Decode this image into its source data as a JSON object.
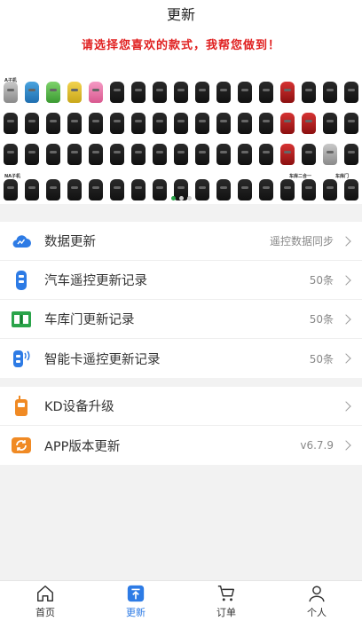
{
  "header": {
    "title": "更新"
  },
  "banner": {
    "slogan": "请选择您喜欢的款式，我帮您做到！",
    "row_labels": [
      "A子机",
      "NA子机",
      "车库二合一",
      "车库门"
    ]
  },
  "update_list": [
    {
      "label": "数据更新",
      "right_text": "遥控数据同步",
      "icon": "cloud-icon"
    },
    {
      "label": "汽车遥控更新记录",
      "right_text": "50条",
      "icon": "car-remote-icon"
    },
    {
      "label": "车库门更新记录",
      "right_text": "50条",
      "icon": "garage-door-icon"
    },
    {
      "label": "智能卡遥控更新记录",
      "right_text": "50条",
      "icon": "smart-card-icon"
    }
  ],
  "device_list": [
    {
      "label": "KD设备升级",
      "right_text": "",
      "icon": "kd-device-icon"
    },
    {
      "label": "APP版本更新",
      "right_text": "v6.7.9",
      "icon": "app-update-icon"
    }
  ],
  "tabbar": [
    {
      "label": "首页",
      "icon": "home-icon",
      "active": false
    },
    {
      "label": "更新",
      "icon": "update-icon",
      "active": true
    },
    {
      "label": "订单",
      "icon": "cart-icon",
      "active": false
    },
    {
      "label": "个人",
      "icon": "person-icon",
      "active": false
    }
  ],
  "colors": {
    "accent": "#2d7be5",
    "slogan": "#e02020",
    "orange": "#f08a24",
    "green": "#2aa44a"
  }
}
